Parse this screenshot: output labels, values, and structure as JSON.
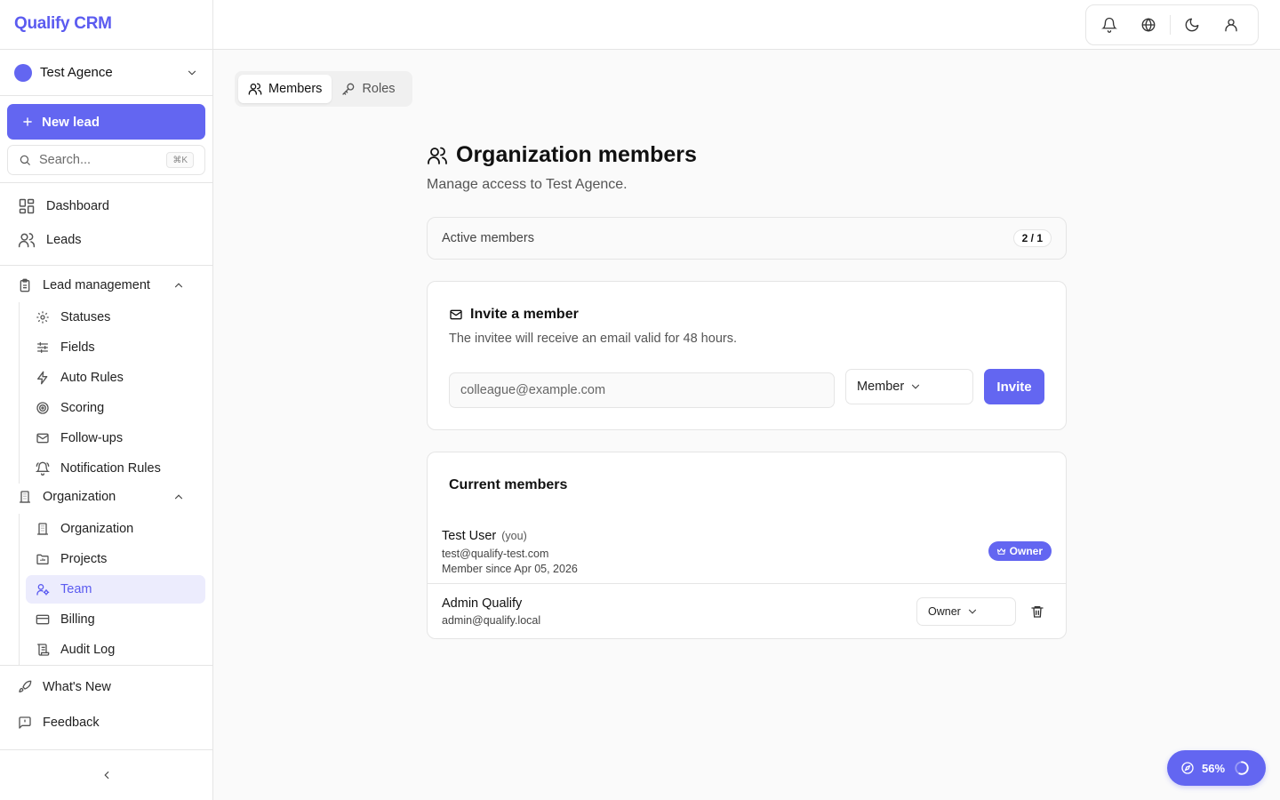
{
  "app": {
    "brand": "Qualify CRM"
  },
  "org_switcher": {
    "name": "Test Agence",
    "color": "#6366f1"
  },
  "sidebar": {
    "new_lead_label": "New lead",
    "search_placeholder": "Search...",
    "search_shortcut": "⌘K",
    "main_items": [
      {
        "label": "Dashboard",
        "icon": "dashboard-icon"
      },
      {
        "label": "Leads",
        "icon": "users-icon"
      }
    ],
    "groups": [
      {
        "label": "Lead management",
        "icon": "clipboard-icon",
        "items": [
          {
            "label": "Statuses",
            "icon": "gear-icon"
          },
          {
            "label": "Fields",
            "icon": "sliders-icon"
          },
          {
            "label": "Auto Rules",
            "icon": "bolt-icon"
          },
          {
            "label": "Scoring",
            "icon": "target-icon"
          },
          {
            "label": "Follow-ups",
            "icon": "mail-icon"
          },
          {
            "label": "Notification Rules",
            "icon": "bell-ring-icon"
          }
        ]
      },
      {
        "label": "Organization",
        "icon": "building-icon",
        "items": [
          {
            "label": "Organization",
            "icon": "building-icon"
          },
          {
            "label": "Projects",
            "icon": "folder-icon"
          },
          {
            "label": "Team",
            "icon": "user-cog-icon",
            "active": true
          },
          {
            "label": "Billing",
            "icon": "credit-card-icon"
          },
          {
            "label": "Audit Log",
            "icon": "scroll-icon"
          }
        ]
      }
    ],
    "footer_items": [
      {
        "label": "What's New",
        "icon": "rocket-icon"
      },
      {
        "label": "Feedback",
        "icon": "message-icon"
      }
    ]
  },
  "tabs": [
    {
      "label": "Members",
      "icon": "users-icon",
      "active": true
    },
    {
      "label": "Roles",
      "icon": "key-icon",
      "active": false
    }
  ],
  "page": {
    "title": "Organization members",
    "subtitle": "Manage access to Test Agence."
  },
  "active_members": {
    "label": "Active members",
    "count": "2 / 1"
  },
  "invite": {
    "title": "Invite a member",
    "description": "The invitee will receive an email valid for 48 hours.",
    "email_placeholder": "colleague@example.com",
    "role_value": "Member",
    "button_label": "Invite"
  },
  "members": {
    "title": "Current members",
    "list": [
      {
        "name": "Test User",
        "you_label": "(you)",
        "email": "test@qualify-test.com",
        "since": "Member since Apr 05, 2026",
        "badge": "Owner"
      },
      {
        "name": "Admin Qualify",
        "email": "admin@qualify.local",
        "role": "Owner"
      }
    ]
  },
  "progress_widget": {
    "label": "56%",
    "value": 0.56
  },
  "colors": {
    "accent": "#6366f1",
    "active_bg": "#ececfd"
  }
}
